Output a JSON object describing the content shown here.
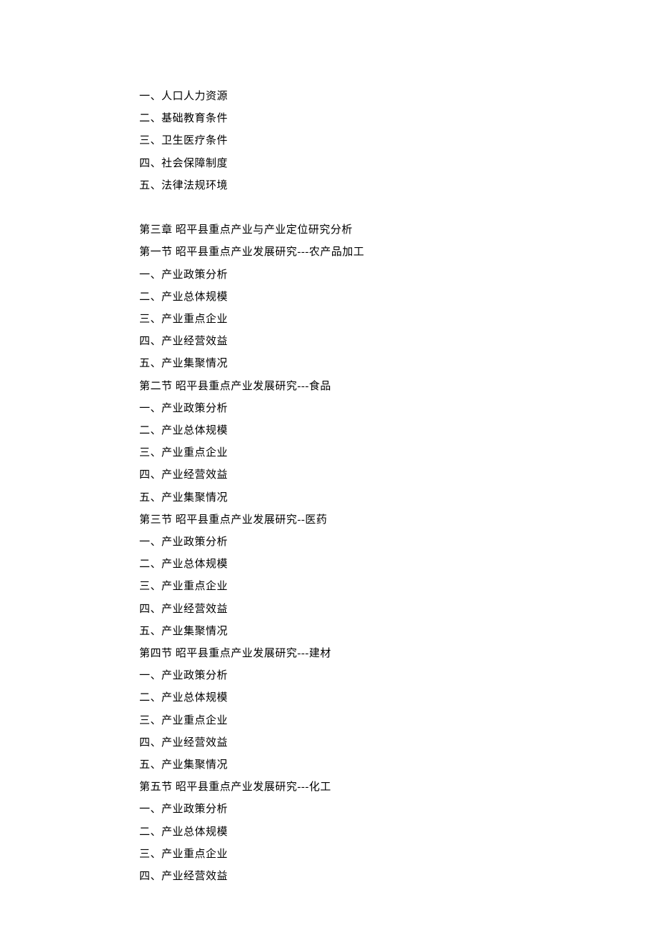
{
  "lines": [
    "一、人口人力资源",
    "二、基础教育条件",
    "三、卫生医疗条件",
    "四、社会保障制度",
    "五、法律法规环境",
    "",
    "第三章 昭平县重点产业与产业定位研究分析",
    "第一节 昭平县重点产业发展研究---农产品加工",
    "一、产业政策分析",
    "二、产业总体规模",
    "三、产业重点企业",
    "四、产业经营效益",
    "五、产业集聚情况",
    "第二节 昭平县重点产业发展研究---食品",
    "一、产业政策分析",
    "二、产业总体规模",
    "三、产业重点企业",
    "四、产业经营效益",
    "五、产业集聚情况",
    "第三节 昭平县重点产业发展研究--医药",
    "一、产业政策分析",
    "二、产业总体规模",
    "三、产业重点企业",
    "四、产业经营效益",
    "五、产业集聚情况",
    "第四节 昭平县重点产业发展研究---建材",
    "一、产业政策分析",
    "二、产业总体规模",
    "三、产业重点企业",
    "四、产业经营效益",
    "五、产业集聚情况",
    "第五节 昭平县重点产业发展研究---化工",
    "一、产业政策分析",
    "二、产业总体规模",
    "三、产业重点企业",
    "四、产业经营效益"
  ]
}
